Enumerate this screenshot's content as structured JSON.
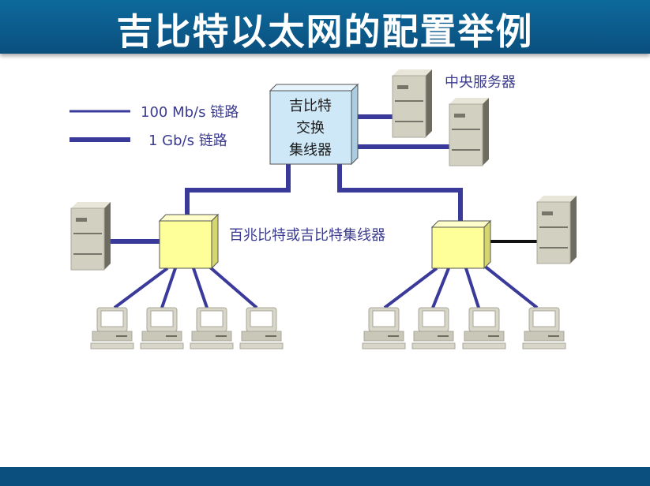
{
  "title": "吉比特以太网的配置举例",
  "legend": {
    "fast": "100 Mb/s 链路",
    "gig": "1 Gb/s 链路"
  },
  "switch_label": [
    "吉比特",
    "交换",
    "集线器"
  ],
  "server_label": "中央服务器",
  "hub_label": "百兆比特或吉比特集线器",
  "colors": {
    "link": "#3a3a9a",
    "switch": "#cfe8f8",
    "hub": "#ffff99",
    "title_bg": "#0a5a8a"
  }
}
